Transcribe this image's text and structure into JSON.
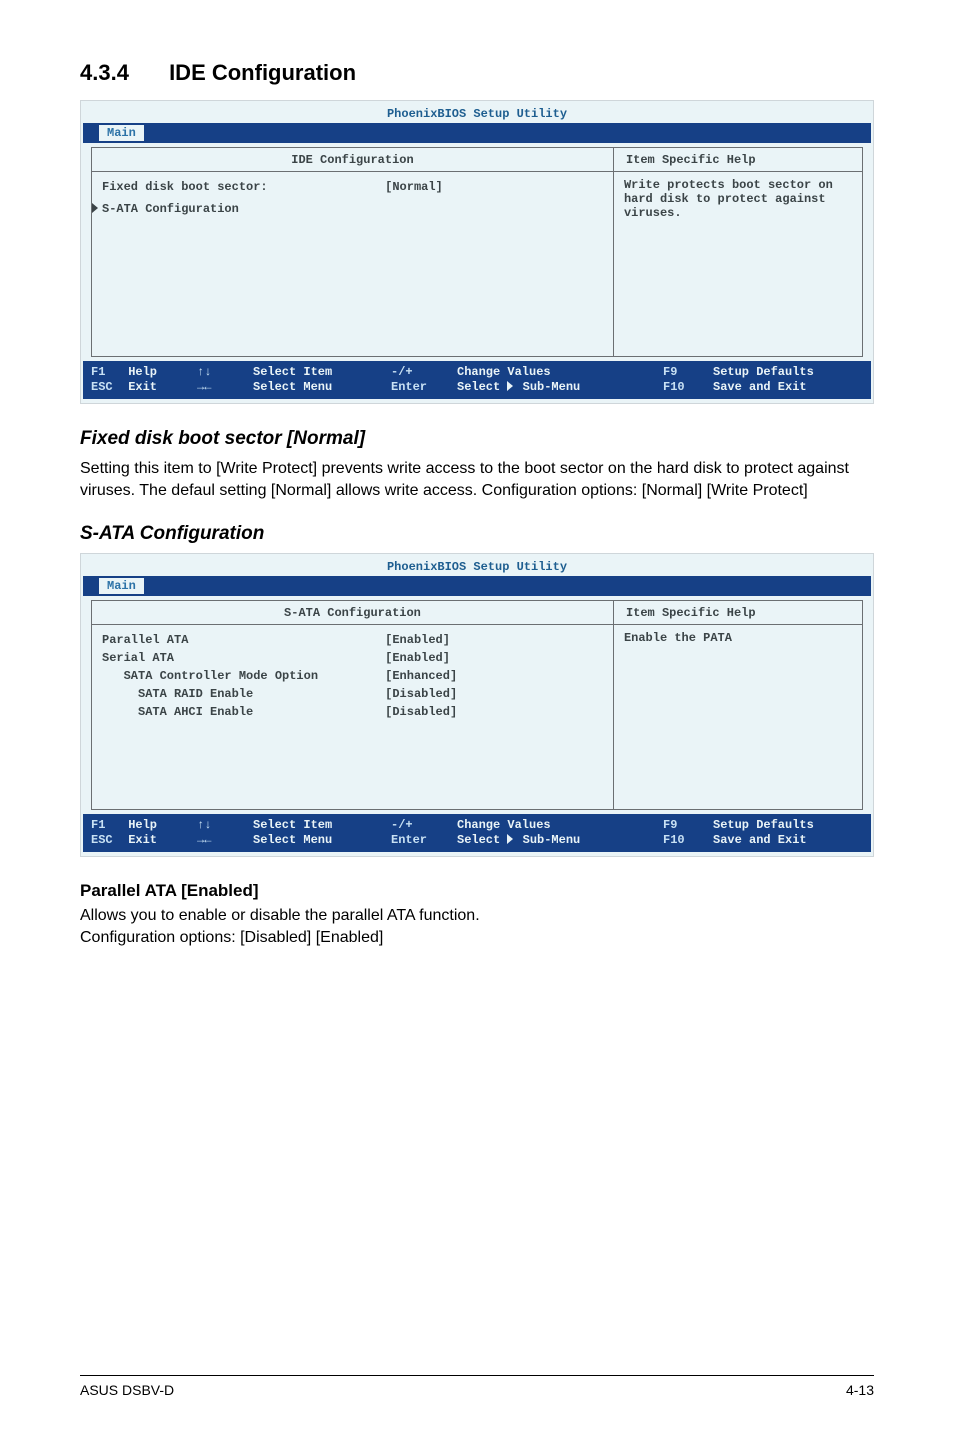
{
  "heading": {
    "number": "4.3.4",
    "title": "IDE Configuration"
  },
  "bios1": {
    "app_title": "PhoenixBIOS Setup Utility",
    "tab": "Main",
    "left_header": "IDE Configuration",
    "right_header": "Item Specific Help",
    "rows": [
      {
        "label": "Fixed disk boot sector:",
        "val": "[Normal]"
      },
      {
        "label": "S-ATA Configuration",
        "val": ""
      }
    ],
    "help_text": "Write protects boot sector on hard disk to protect against viruses.",
    "footer": {
      "f1": "F1",
      "help": "Help",
      "esc": "ESC",
      "exit": "Exit",
      "ud": "↑↓",
      "select_item": "Select Item",
      "lr": "→←",
      "select_menu": "Select Menu",
      "mp": "-/+",
      "change": "Change Values",
      "enter": "Enter",
      "select_sub": "Select    Sub-Menu",
      "f9": "F9",
      "defaults": "Setup Defaults",
      "f10": "F10",
      "save": "Save and Exit"
    }
  },
  "sub1": {
    "title": "Fixed disk boot sector [Normal]",
    "body": "Setting this item to [Write Protect] prevents write access to the boot sector on the hard disk to protect against viruses. The defaul setting [Normal] allows write access. Configuration options: [Normal] [Write Protect]"
  },
  "sub2_title": "S-ATA Configuration",
  "bios2": {
    "app_title": "PhoenixBIOS Setup Utility",
    "tab": "Main",
    "left_header": "S-ATA Configuration",
    "right_header": "Item Specific Help",
    "rows": [
      {
        "label": "Parallel ATA",
        "val": "[Enabled]"
      },
      {
        "label": "Serial ATA",
        "val": "[Enabled]"
      },
      {
        "label": "   SATA Controller Mode Option",
        "val": "[Enhanced]"
      },
      {
        "label": "     SATA RAID Enable",
        "val": "[Disabled]"
      },
      {
        "label": "     SATA AHCI Enable",
        "val": "[Disabled]"
      }
    ],
    "help_text": "Enable the PATA"
  },
  "sub3": {
    "title": "Parallel ATA [Enabled]",
    "line1": "Allows you to enable or disable the parallel ATA function.",
    "line2": "Configuration options: [Disabled] [Enabled]"
  },
  "footer": {
    "left": "ASUS DSBV-D",
    "right": "4-13"
  }
}
